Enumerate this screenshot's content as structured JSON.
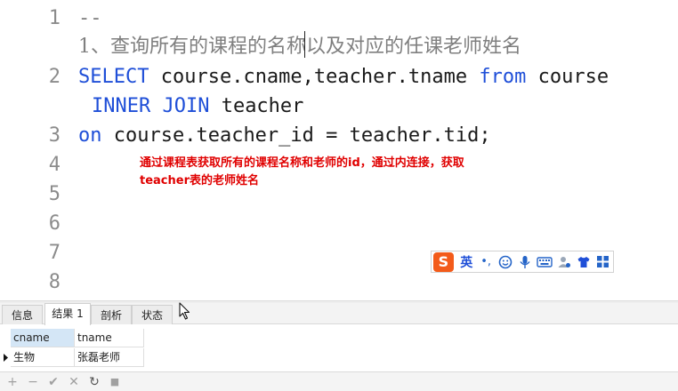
{
  "editor": {
    "line_numbers": [
      "1",
      "2",
      "3",
      "4",
      "5",
      "6",
      "7",
      "8"
    ],
    "comment_line_1": "--",
    "comment_line_2": "1、查询所有的课程的名称以及对应的任课老师姓名",
    "sql_line_2_kw1": "SELECT",
    "sql_line_2_mid": " course.cname,teacher.tname ",
    "sql_line_2_kw2": "from",
    "sql_line_2_tail": " course",
    "sql_line_2b_kw": "INNER JOIN",
    "sql_line_2b_tail": " teacher",
    "sql_line_3_kw": "on",
    "sql_line_3_tail": " course.teacher_id = teacher.tid;",
    "annotation_line_1": "通过课程表获取所有的课程名称和老师的id，通过内连接，获取",
    "annotation_line_2": "teacher表的老师姓名"
  },
  "ime": {
    "logo": "S",
    "mode_label": "英",
    "punct": "•,",
    "icons": [
      "emoji-icon",
      "microphone-icon",
      "keyboard-icon",
      "user-icon",
      "shirt-icon",
      "grid-icon"
    ]
  },
  "tabs": [
    {
      "label": "信息"
    },
    {
      "label": "结果 1"
    },
    {
      "label": "剖析"
    },
    {
      "label": "状态"
    }
  ],
  "result": {
    "columns": [
      "cname",
      "tname"
    ],
    "rows": [
      [
        "生物",
        "张磊老师"
      ]
    ]
  },
  "toolbar": {
    "add": "+",
    "remove": "−",
    "apply": "✔",
    "discard": "✕",
    "refresh": "↻",
    "stop": "■"
  },
  "colors": {
    "keyword": "#1f4fd8",
    "annotation": "#e00000",
    "ime_logo": "#f35b1a",
    "selected_header": "#d4e6f6"
  }
}
